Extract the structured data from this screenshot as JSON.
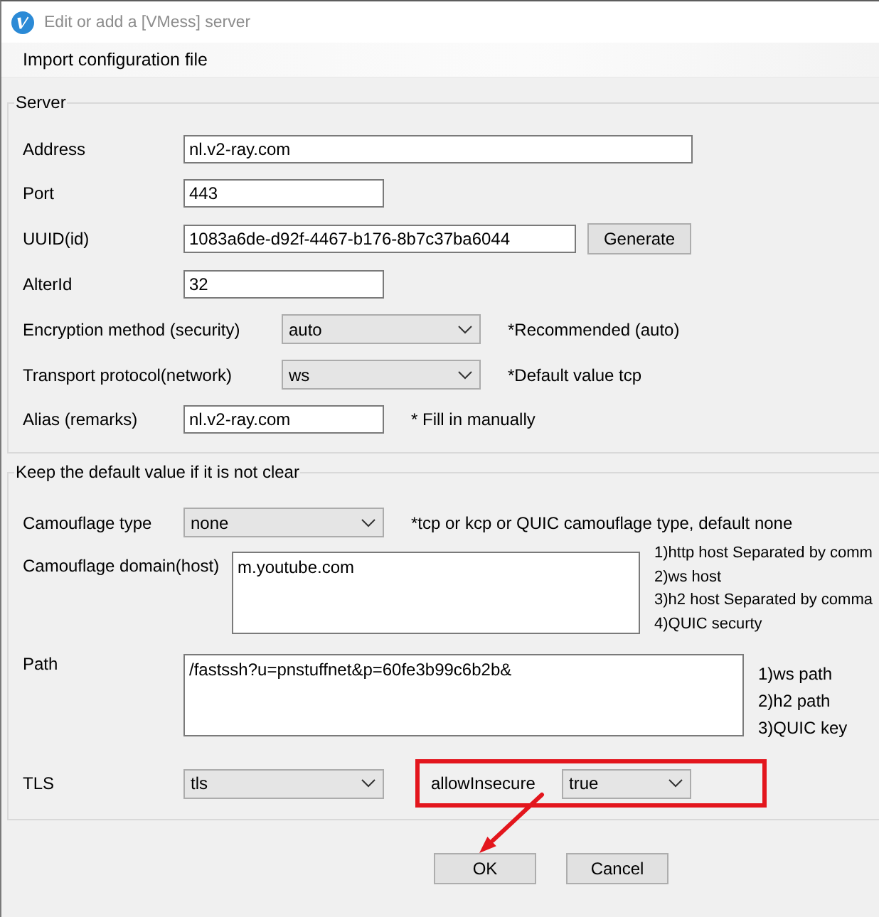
{
  "window": {
    "title": "Edit or add a [VMess] server"
  },
  "menu": [
    {
      "label": "Import configuration file"
    }
  ],
  "server": {
    "title": "Server",
    "rows": [
      {
        "kind": "text",
        "label": "Address",
        "value": "nl.v2-ray.com"
      },
      {
        "kind": "text",
        "label": "Port",
        "value": "443"
      },
      {
        "kind": "text",
        "label": "UUID(id)",
        "value": "1083a6de-d92f-4467-b176-8b7c37ba6044",
        "button": "Generate"
      },
      {
        "kind": "text",
        "label": "AlterId",
        "value": "32"
      },
      {
        "kind": "select",
        "label": "Encryption method (security)",
        "value": "auto",
        "hint": "*Recommended (auto)"
      },
      {
        "kind": "select",
        "label": "Transport protocol(network)",
        "value": "ws",
        "hint": "*Default value tcp"
      },
      {
        "kind": "text",
        "label": "Alias (remarks)",
        "value": "nl.v2-ray.com",
        "hint": "* Fill in manually"
      }
    ]
  },
  "advanced": {
    "title": "Keep the default value if it is not clear",
    "rows": [
      {
        "kind": "select",
        "label": "Camouflage type",
        "value": "none",
        "hint": "*tcp or kcp or QUIC camouflage type, default none"
      },
      {
        "kind": "textarea",
        "label": "Camouflage domain(host)",
        "value": "m.youtube.com",
        "notes": [
          "1)http host Separated by comm",
          "2)ws host",
          "3)h2 host Separated by comma",
          "4)QUIC securty"
        ]
      },
      {
        "kind": "textarea",
        "label": "Path",
        "value": "/fastssh?u=pnstuffnet&p=60fe3b99c6b2b&",
        "notes": [
          "1)ws path",
          "2)h2 path",
          "3)QUIC key"
        ]
      },
      {
        "kind": "select",
        "label": "TLS",
        "value": "tls",
        "extra": {
          "label": "allowInsecure",
          "value": "true",
          "highlighted": true
        }
      }
    ]
  },
  "buttons": [
    "OK",
    "Cancel"
  ]
}
